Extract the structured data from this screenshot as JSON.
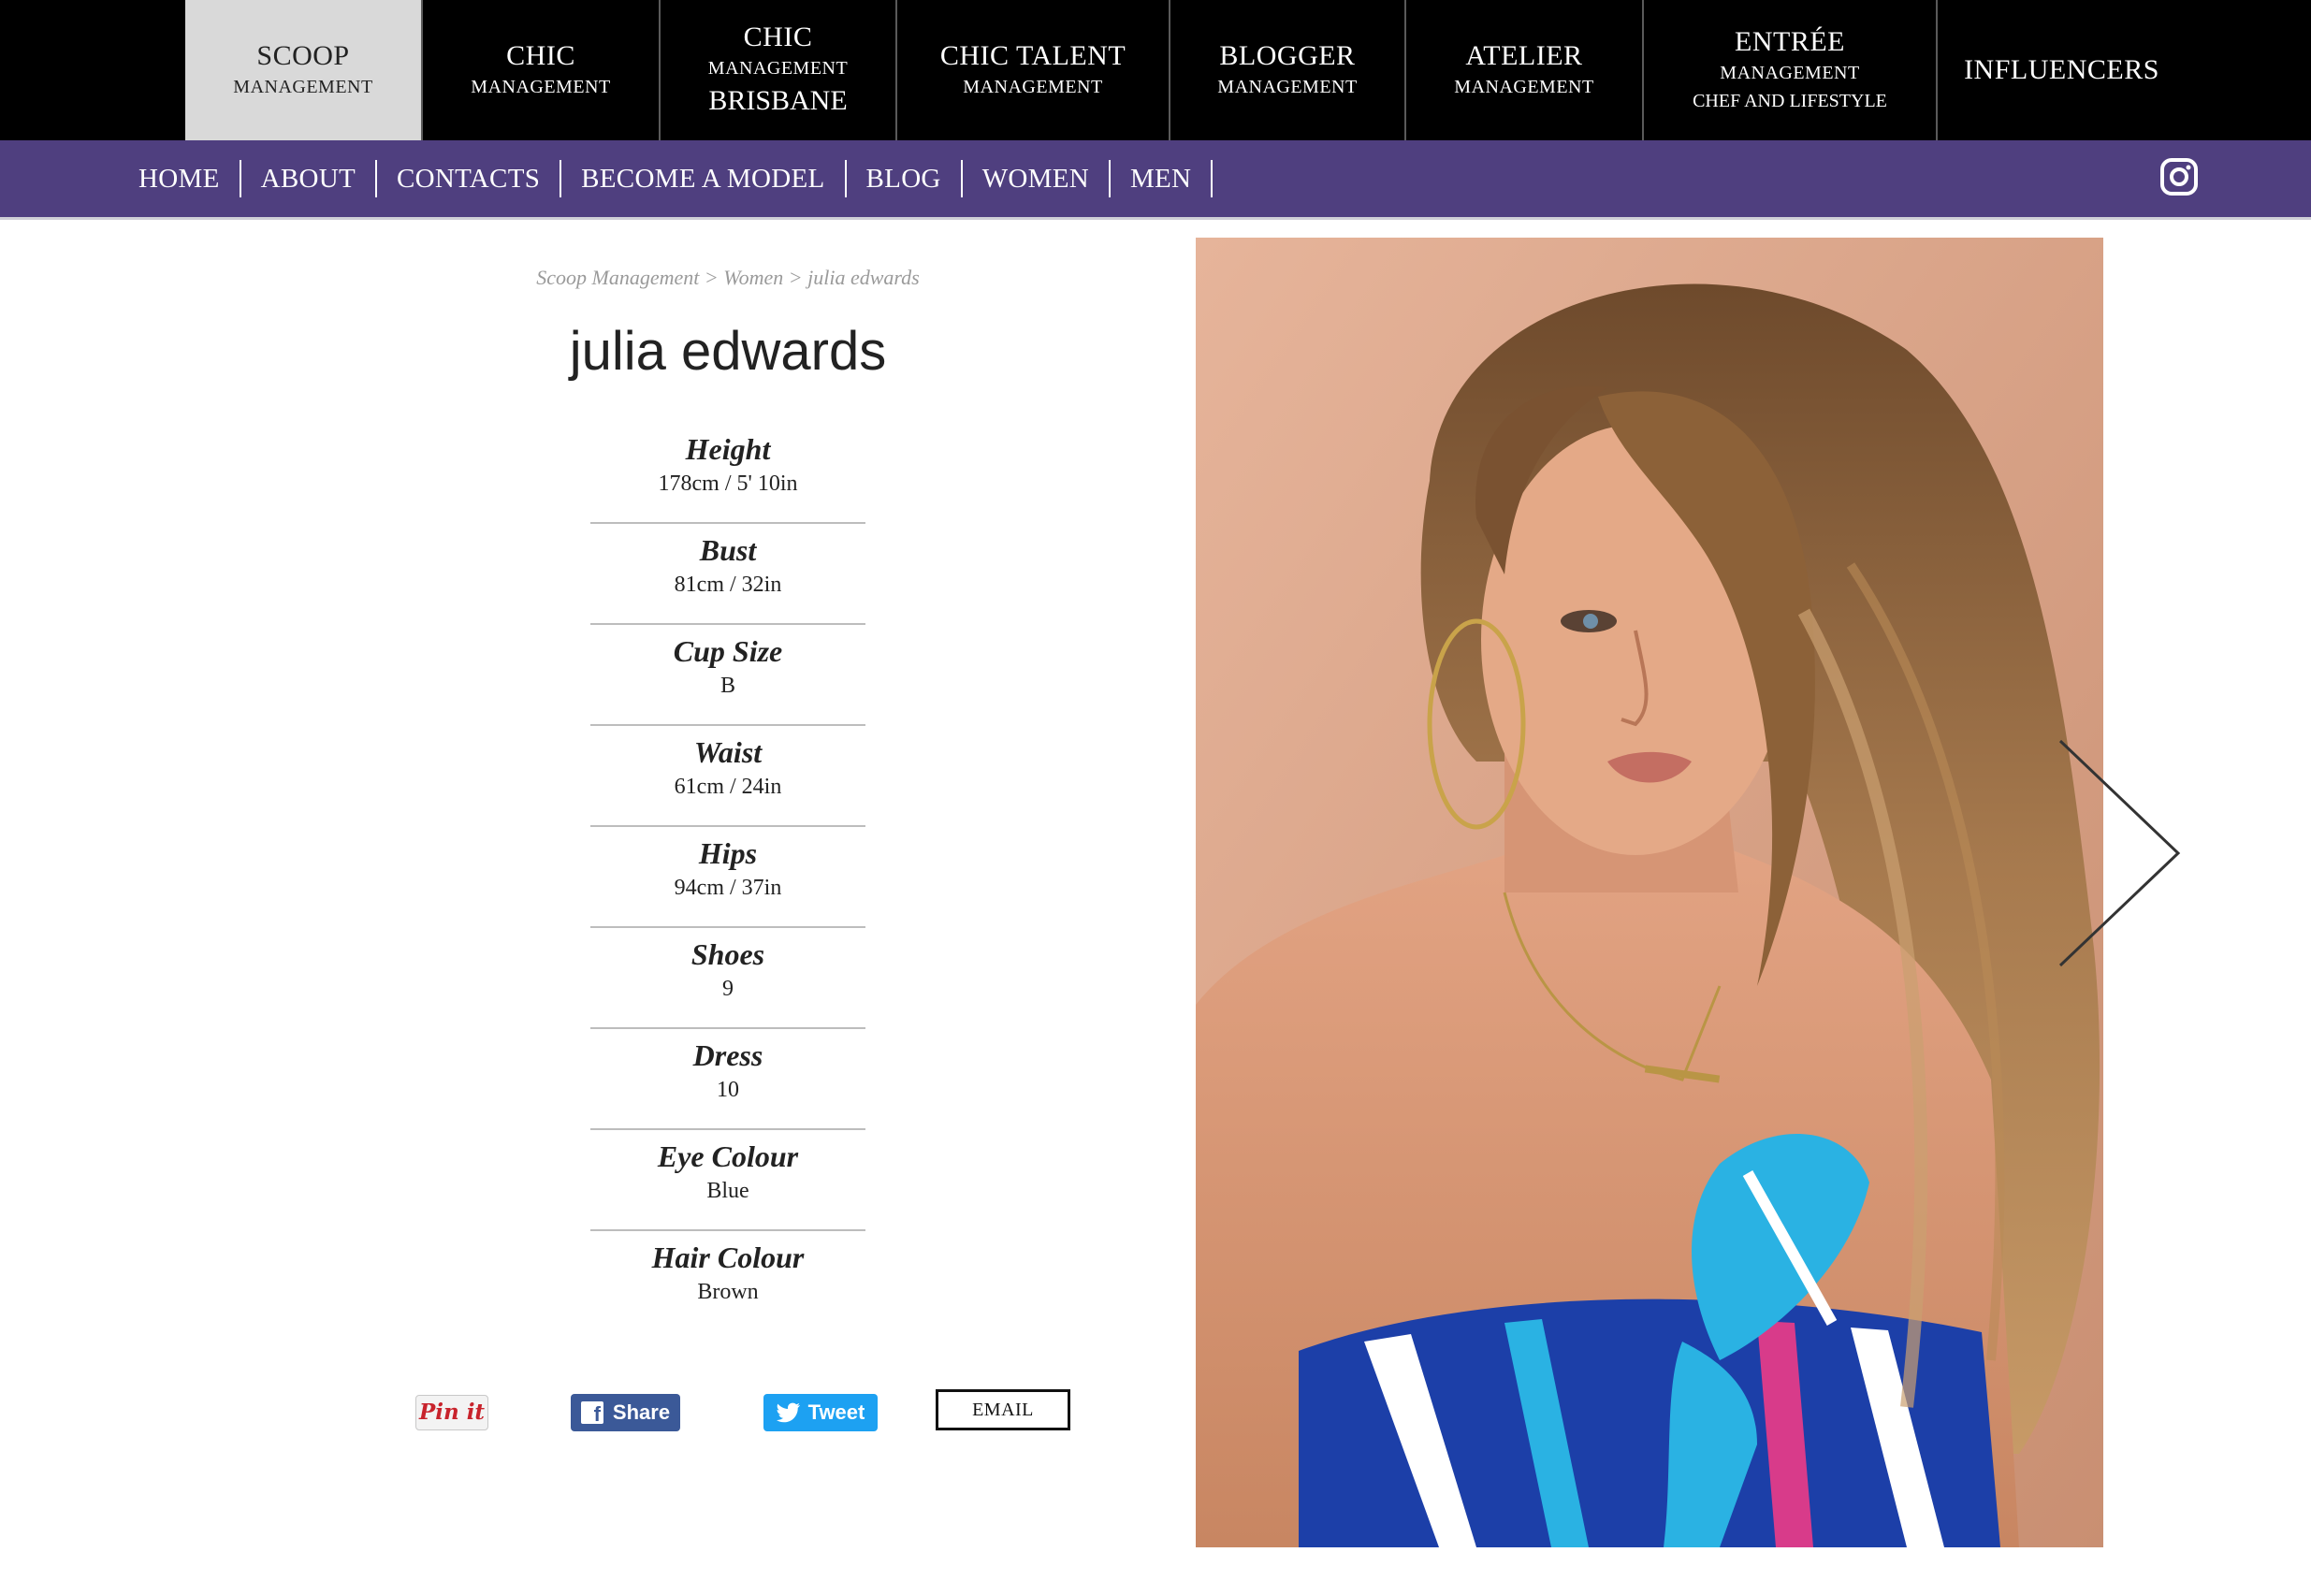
{
  "agencies": [
    {
      "title": "SCOOP",
      "sub": "MANAGEMENT",
      "line3": "",
      "active": true
    },
    {
      "title": "CHIC",
      "sub": "MANAGEMENT",
      "line3": ""
    },
    {
      "title": "CHIC",
      "sub": "MANAGEMENT",
      "line3": "BRISBANE"
    },
    {
      "title": "CHIC TALENT",
      "sub": "MANAGEMENT",
      "line3": ""
    },
    {
      "title": "BLOGGER",
      "sub": "MANAGEMENT",
      "line3": ""
    },
    {
      "title": "ATELIER",
      "sub": "MANAGEMENT",
      "line3": ""
    },
    {
      "title": "ENTRÉE",
      "sub": "MANAGEMENT",
      "line3": "CHEF AND LIFESTYLE"
    },
    {
      "title": "INFLUENCERS",
      "sub": "",
      "line3": ""
    }
  ],
  "nav": [
    "HOME",
    "ABOUT",
    "CONTACTS",
    "BECOME A MODEL",
    "BLOG",
    "WOMEN",
    "MEN"
  ],
  "breadcrumb": [
    "Scoop Management",
    "Women",
    "julia edwards"
  ],
  "breadcrumb_sep": ">",
  "model": {
    "name": "julia edwards"
  },
  "stats": [
    {
      "label": "Height",
      "value": "178cm / 5' 10in"
    },
    {
      "label": "Bust",
      "value": "81cm / 32in"
    },
    {
      "label": "Cup Size",
      "value": "B"
    },
    {
      "label": "Waist",
      "value": "61cm / 24in"
    },
    {
      "label": "Hips",
      "value": "94cm / 37in"
    },
    {
      "label": "Shoes",
      "value": "9"
    },
    {
      "label": "Dress",
      "value": "10"
    },
    {
      "label": "Eye Colour",
      "value": "Blue"
    },
    {
      "label": "Hair Colour",
      "value": "Brown"
    }
  ],
  "share": {
    "pin": "Pin it",
    "facebook": "Share",
    "twitter": "Tweet",
    "email": "EMAIL"
  },
  "icons": {
    "instagram": "instagram-icon",
    "next": "chevron-right-icon",
    "facebook": "facebook-icon",
    "twitter": "twitter-icon"
  },
  "colors": {
    "top_bar": "#000000",
    "active_tab": "#d9d9d9",
    "nav_bar": "#4f3f7f",
    "facebook": "#3b5998",
    "twitter": "#1da1f2",
    "pinterest": "#c8232c"
  }
}
